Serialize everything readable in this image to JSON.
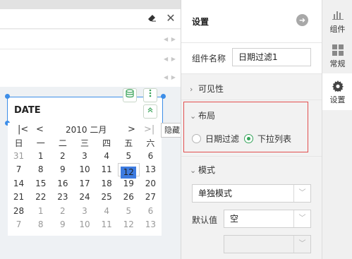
{
  "canvas": {
    "toolbar": {
      "eraser_icon": "eraser-icon",
      "close_glyph": "✕"
    },
    "row_arrows": "◀ ▶",
    "date_widget": {
      "label": "DATE",
      "tooltip": "隐藏",
      "icons": [
        "database-icon",
        "more-vert-icon",
        "collapse-up-icon"
      ]
    },
    "calendar": {
      "nav": {
        "first": "|<",
        "prev": "<",
        "title": "2010 二月",
        "next": ">",
        "last": ">|"
      },
      "weekdays": [
        "日",
        "一",
        "二",
        "三",
        "四",
        "五",
        "六"
      ],
      "weeks": [
        [
          "31",
          "1",
          "2",
          "3",
          "4",
          "5",
          "6"
        ],
        [
          "7",
          "8",
          "9",
          "10",
          "11",
          "12",
          "13"
        ],
        [
          "14",
          "15",
          "16",
          "17",
          "18",
          "19",
          "20"
        ],
        [
          "21",
          "22",
          "23",
          "24",
          "25",
          "26",
          "27"
        ],
        [
          "28",
          "1",
          "2",
          "3",
          "4",
          "5",
          "6"
        ],
        [
          "7",
          "8",
          "9",
          "10",
          "11",
          "12",
          "13"
        ]
      ],
      "selected_day": "12",
      "selected_color": "#3d7be0"
    }
  },
  "panel": {
    "title": "设置",
    "component_name_label": "组件名称",
    "component_name_value": "日期过滤1",
    "visibility": {
      "label": "可见性",
      "collapsed": true
    },
    "layout": {
      "label": "布局",
      "options": [
        {
          "label": "日期过滤",
          "checked": false
        },
        {
          "label": "下拉列表",
          "checked": true
        }
      ]
    },
    "style": {
      "label": "模式",
      "mode_value": "单独模式",
      "default_label": "默认值",
      "default_value": "空",
      "extra_value": ""
    },
    "highlight_color": "#e24e4e",
    "accent_color": "#35a45a"
  },
  "tabs": [
    {
      "label": "组件",
      "icon": "bar-chart-icon",
      "active": false
    },
    {
      "label": "常规",
      "icon": "grid-icon",
      "active": false
    },
    {
      "label": "设置",
      "icon": "gear-icon",
      "active": true
    }
  ]
}
